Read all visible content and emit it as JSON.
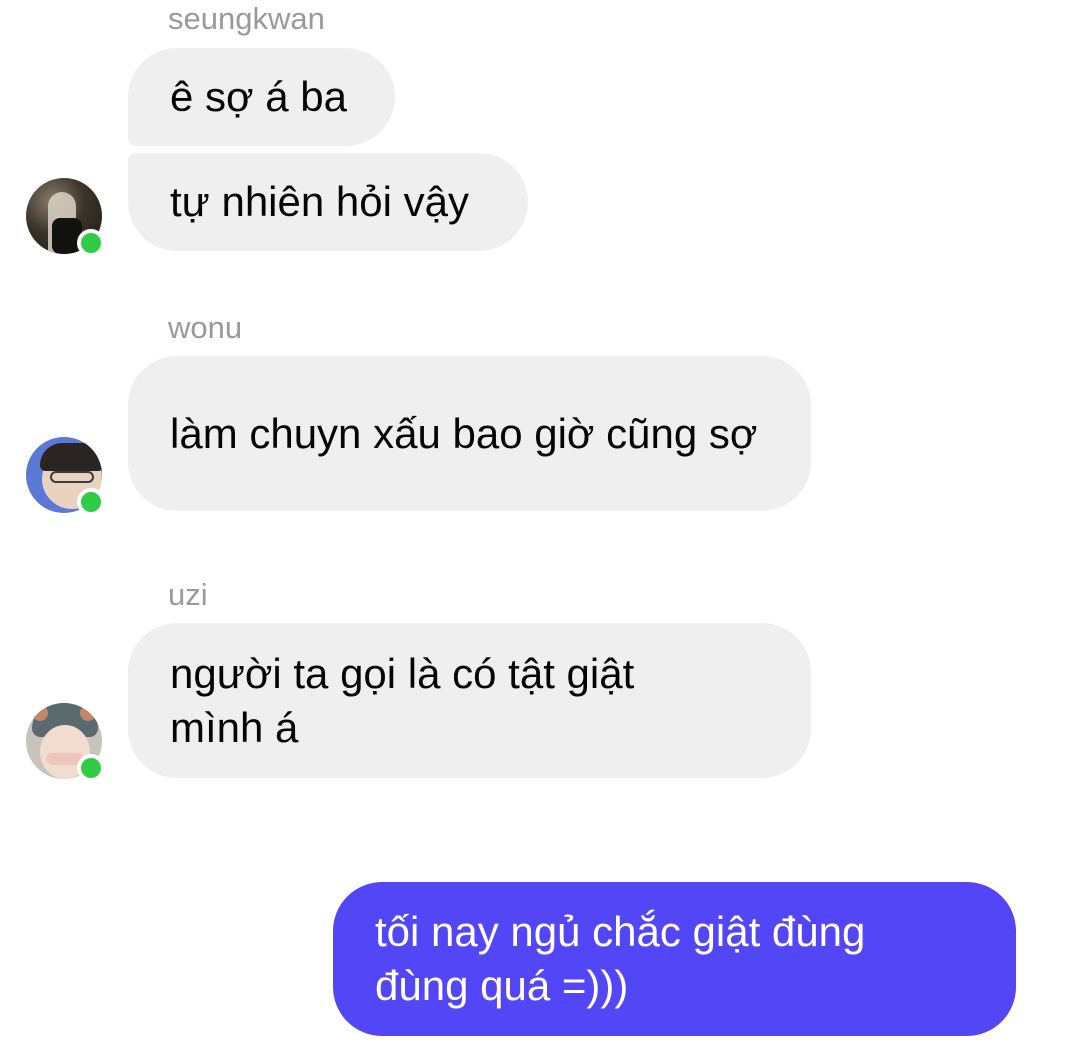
{
  "conversation": {
    "groups": [
      {
        "sender": "seungkwan",
        "messages": [
          "ê sợ á ba",
          "tự nhiên hỏi vậy"
        ]
      },
      {
        "sender": "wonu",
        "messages": [
          "làm chuyn xấu bao giờ cũng sợ"
        ]
      },
      {
        "sender": "uzi",
        "messages": [
          "người ta gọi là có tật giật mình á"
        ]
      }
    ],
    "outgoing": {
      "messages": [
        "tối nay ngủ chắc giật đùng đùng quá =)))"
      ],
      "bubble_color": "#5346f7"
    }
  },
  "colors": {
    "incoming_bubble": "#efefef",
    "online_indicator": "#31cc46",
    "sender_name": "#9a9a9a"
  }
}
